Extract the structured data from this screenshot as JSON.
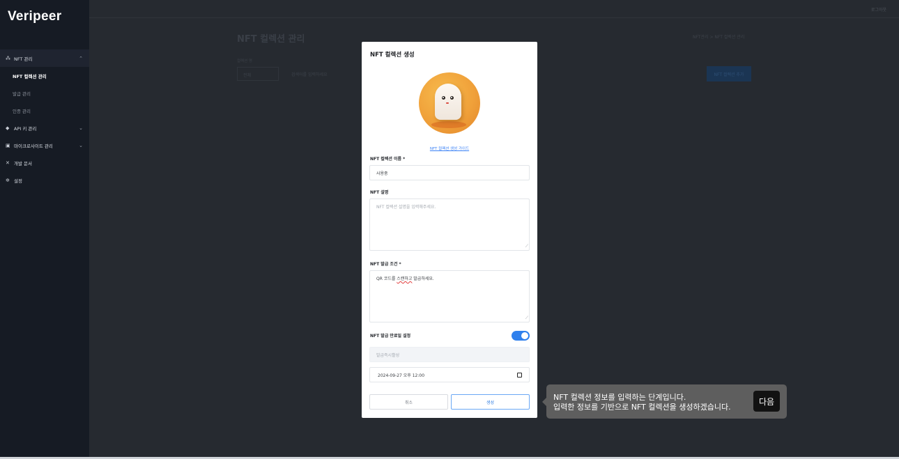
{
  "sidebar": {
    "logo": "Veripeer",
    "menu": [
      {
        "label": "NFT 관리",
        "icon": "sitemap-icon",
        "expanded": true
      },
      {
        "label": "API 키 관리",
        "icon": "tag-icon"
      },
      {
        "label": "마이크로사이트 관리",
        "icon": "window-icon"
      },
      {
        "label": "개발 문서",
        "icon": "tools-icon"
      },
      {
        "label": "설정",
        "icon": "gear-icon"
      }
    ],
    "nft_sub": [
      "NFT 컬렉션 관리",
      "발급 관리",
      "인증 관리"
    ]
  },
  "background": {
    "logout": "로그아웃",
    "page_title": "NFT 컬렉션 관리",
    "breadcrumb": "NFT관리 > NFT 컬렉션 관리",
    "filter_label": "컬렉션 명",
    "select_value": "전체",
    "search_placeholder": "검색어를 입력하세요",
    "add_button": "NFT 컬렉션 추가"
  },
  "modal": {
    "title": "NFT 컬렉션 생성",
    "guide_link": "NFT 컬렉션 생성 가이드",
    "name_label": "NFT 컬렉션 이름 *",
    "name_value": "사용중",
    "desc_label": "NFT 설명",
    "desc_placeholder": "NFT 컬렉션 설명을 입력해주세요.",
    "cond_label": "NFT 발급 조건 *",
    "cond_before": "QR 코드를 ",
    "cond_spell": "스캔하고",
    "cond_after": " 발급하세요.",
    "expiry_label": "NFT 발급 만료일 설정",
    "expiry_enabled": true,
    "expiry_readonly": "발급즉시활성",
    "expiry_date": "2024-09-27 오후 12:00",
    "cancel": "취소",
    "create": "생성"
  },
  "tooltip": {
    "line1": "NFT 컬렉션 정보를 입력하는 단계입니다.",
    "line2": "입력한 정보를 기반으로 NFT 컬렉션을 생성하겠습니다.",
    "next": "다음"
  }
}
